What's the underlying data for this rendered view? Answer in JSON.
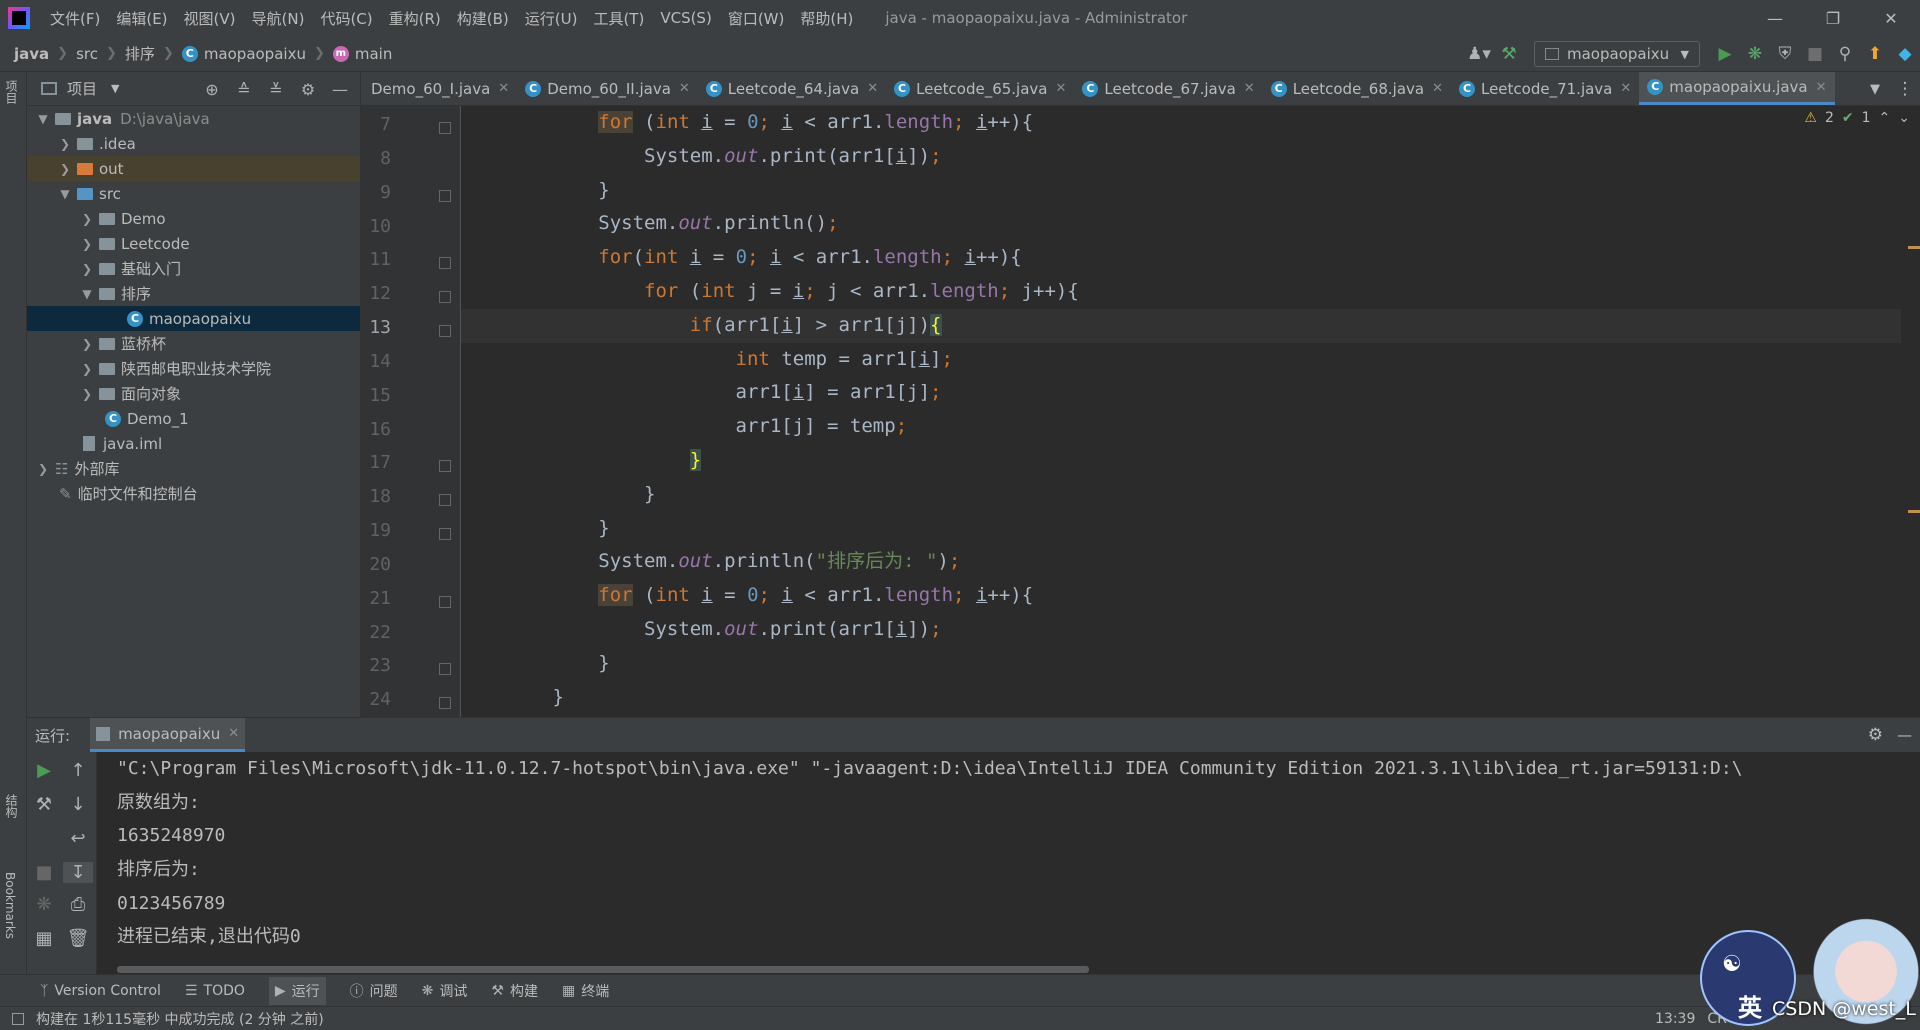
{
  "menu": [
    "文件(F)",
    "编辑(E)",
    "视图(V)",
    "导航(N)",
    "代码(C)",
    "重构(R)",
    "构建(B)",
    "运行(U)",
    "工具(T)",
    "VCS(S)",
    "窗口(W)",
    "帮助(H)"
  ],
  "window_title": "java - maopaopaixu.java - Administrator",
  "breadcrumbs": [
    "java",
    "src",
    "排序",
    "maopaopaixu",
    "main"
  ],
  "run_config": "maopaopaixu",
  "project_panel": {
    "title": "项目",
    "root_name": "java",
    "root_path": "D:\\java\\java",
    "items": [
      ".idea",
      "out",
      "src",
      "Demo",
      "Leetcode",
      "基础入门",
      "排序",
      "maopaopaixu",
      "蓝桥杯",
      "陕西邮电职业技术学院",
      "面向对象",
      "Demo_1",
      "java.iml",
      "外部库",
      "临时文件和控制台"
    ]
  },
  "tabs": [
    "Demo_60_I.java",
    "Demo_60_II.java",
    "Leetcode_64.java",
    "Leetcode_65.java",
    "Leetcode_67.java",
    "Leetcode_68.java",
    "Leetcode_71.java",
    "maopaopaixu.java"
  ],
  "editor": {
    "line_numbers": [
      "7",
      "8",
      "9",
      "10",
      "11",
      "12",
      "13",
      "14",
      "15",
      "16",
      "17",
      "18",
      "19",
      "20",
      "21",
      "22",
      "23",
      "24"
    ],
    "warnings": "2",
    "ok_count": "1",
    "string_literal": "\"排序后为: \""
  },
  "run_panel": {
    "label": "运行:",
    "tab": "maopaopaixu",
    "console": [
      "\"C:\\Program Files\\Microsoft\\jdk-11.0.12.7-hotspot\\bin\\java.exe\" \"-javaagent:D:\\idea\\IntelliJ IDEA Community Edition 2021.3.1\\lib\\idea_rt.jar=59131:D:\\",
      "原数组为:",
      "1635248970",
      "排序后为:",
      "0123456789",
      "进程已结束,退出代码0"
    ]
  },
  "left_strip": {
    "project": "项目",
    "structure": "结构",
    "bookmarks": "Bookmarks"
  },
  "tool_windows": [
    "Version Control",
    "TODO",
    "运行",
    "问题",
    "调试",
    "构建",
    "终端"
  ],
  "status": {
    "message": "构建在 1秒115毫秒 中成功完成 (2 分钟 之前)",
    "time": "13:39",
    "encoding": "CR"
  },
  "ime": {
    "char": "英"
  },
  "watermark": "CSDN @west_L"
}
